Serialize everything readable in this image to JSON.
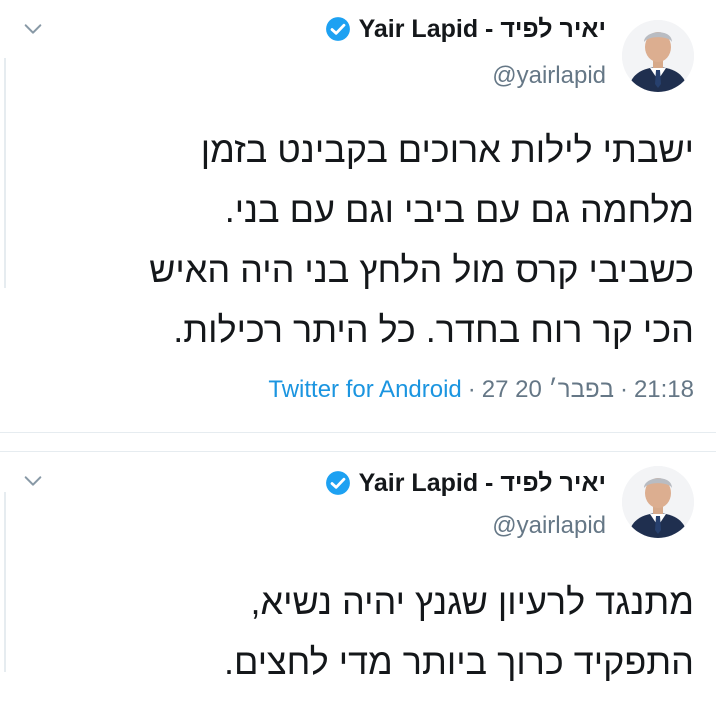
{
  "colors": {
    "text": "#14171a",
    "secondary": "#657786",
    "link": "#1b95e0",
    "verified": "#1da1f2",
    "divider": "#e6ecf0"
  },
  "tweets": [
    {
      "author": {
        "name": "Yair Lapid - יאיר לפיד",
        "handle": "@yairlapid",
        "verified_icon": "verified-badge-icon",
        "avatar_icon": "profile-photo"
      },
      "menu_icon": "chevron-down-icon",
      "lines": [
        "ישבתי לילות ארוכים בקבינט בזמן",
        "מלחמה גם עם ביבי וגם עם בני.",
        "כשביבי קרס מול הלחץ בני היה האיש",
        "הכי קר רוח בחדר. כל היתר רכילות."
      ],
      "meta": {
        "time": "21:18",
        "date": "27 בפבר׳ 20",
        "source": "Twitter for Android"
      }
    },
    {
      "author": {
        "name": "Yair Lapid - יאיר לפיד",
        "handle": "@yairlapid",
        "verified_icon": "verified-badge-icon",
        "avatar_icon": "profile-photo"
      },
      "menu_icon": "chevron-down-icon",
      "lines": [
        "מתנגד לרעיון שגנץ יהיה נשיא,",
        "התפקיד כרוך ביותר מדי לחצים."
      ]
    }
  ]
}
